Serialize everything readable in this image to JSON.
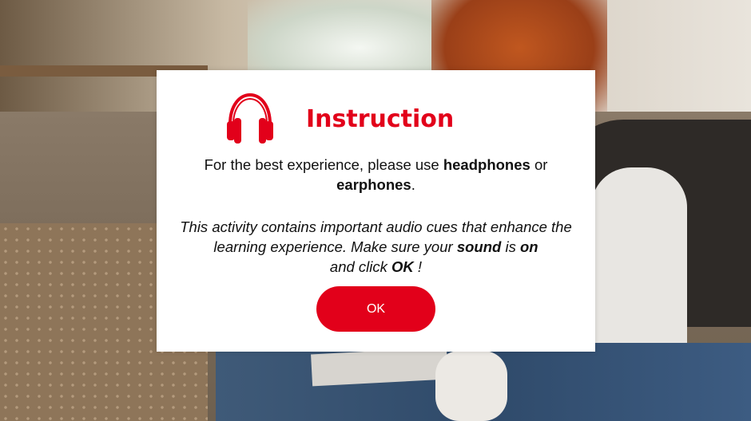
{
  "modal": {
    "title": "Instruction",
    "icon": "headphones-icon",
    "line1": {
      "pre": "For the best experience, please use ",
      "bold1": "headphones",
      "mid": " or",
      "bold2": "earphones",
      "post": "."
    },
    "line2": {
      "part1": "This activity contains important audio cues that enhance the learning experience. Make sure your ",
      "bold_sound": "sound",
      "is": " is ",
      "bold_on": "on",
      "part2": "and click ",
      "bold_ok": "OK",
      "end": " !"
    },
    "ok_button_label": "OK"
  },
  "colors": {
    "accent": "#e2001a",
    "modal_bg": "#ffffff",
    "text": "#111111"
  }
}
